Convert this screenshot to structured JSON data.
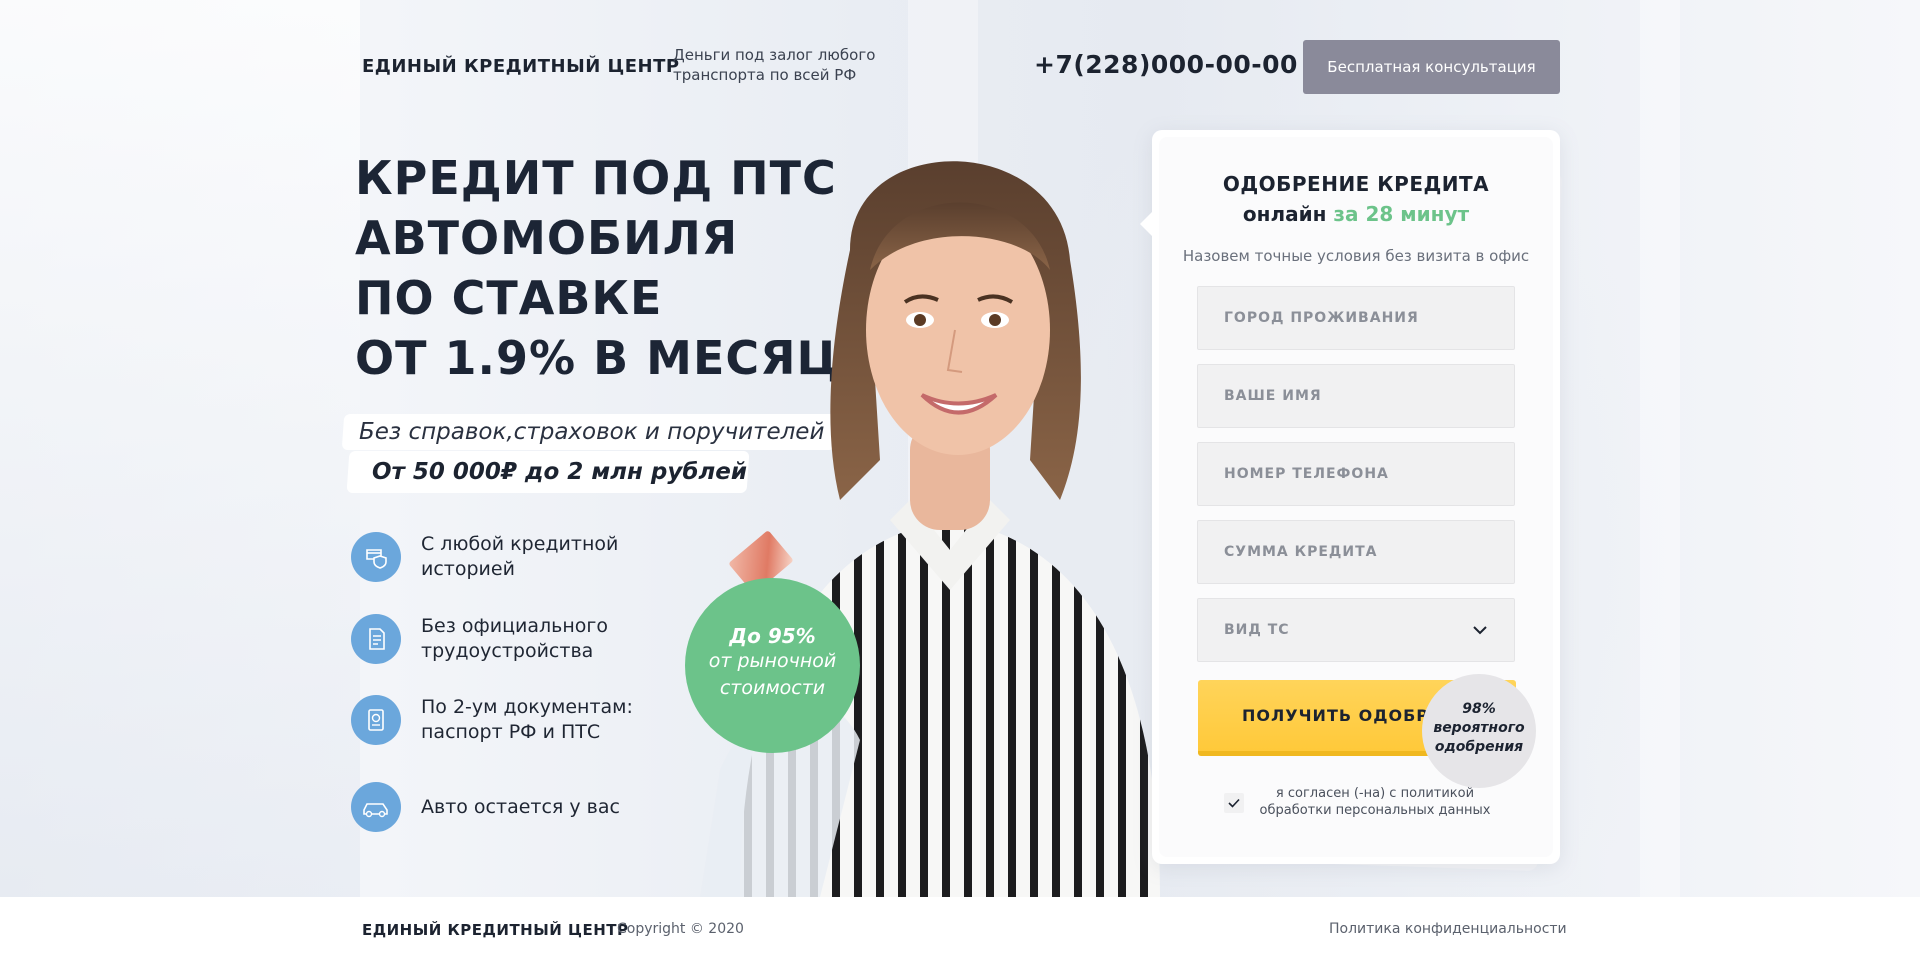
{
  "header": {
    "brand": "ЕДИНЫЙ КРЕДИТНЫЙ ЦЕНТР",
    "tagline_line1": "Деньги под залог любого",
    "tagline_line2": "транспорта по всей РФ",
    "phone": "+7(228)000-00-00",
    "consult_button": "Бесплатная консультация"
  },
  "hero": {
    "headline": [
      "КРЕДИТ ПОД ПТС",
      "АВТОМОБИЛЯ",
      "ПО СТАВКЕ",
      "ОТ 1.9% В МЕСЯЦ"
    ],
    "subtitle": "Без справок,страховок и поручителей",
    "amount": "От 50 000₽ до 2 млн рублей",
    "features": [
      {
        "icon": "credit-card-shield-icon",
        "line1": "С любой кредитной",
        "line2": "историей"
      },
      {
        "icon": "document-icon",
        "line1": "Без официального",
        "line2": "трудоустройства"
      },
      {
        "icon": "passport-icon",
        "line1": "По 2-ум документам:",
        "line2": "паспорт РФ и ПТС"
      },
      {
        "icon": "car-icon",
        "line1": "Авто остается у вас",
        "line2": ""
      }
    ],
    "badge_line1": "До 95%",
    "badge_line2": "от рыночной",
    "badge_line3": "стоимости"
  },
  "form": {
    "title": "ОДОБРЕНИЕ КРЕДИТА",
    "title2_prefix": "онлайн",
    "title2_accent": "за 28 минут",
    "subtitle": "Назовем точные условия без визита в офис",
    "fields": {
      "city_placeholder": "ГОРОД ПРОЖИВАНИЯ",
      "name_placeholder": "ВАШЕ ИМЯ",
      "phone_placeholder": "НОМЕР ТЕЛЕФОНА",
      "amount_placeholder": "СУММА КРЕДИТА",
      "vehicle_select": "ВИД ТС"
    },
    "submit": "ПОЛУЧИТЬ ОДОБРЕНИЕ",
    "prob_line1": "98%",
    "prob_line2": "вероятного",
    "prob_line3": "одобрения",
    "consent_line1": "я согласен (-на) с политикой",
    "consent_line2": "обработки персональных данных",
    "colors": {
      "accent": "#6cc38a",
      "cta": "#ffd14f"
    }
  },
  "footer": {
    "brand": "ЕДИНЫЙ КРЕДИТНЫЙ ЦЕНТР",
    "copyright": "Copyright © 2020",
    "policy": "Политика конфиденциальности"
  }
}
